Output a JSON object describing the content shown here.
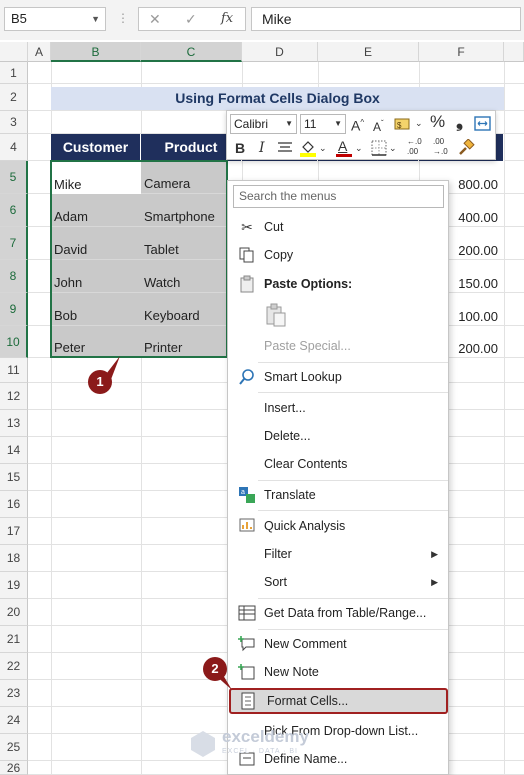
{
  "formula_bar": {
    "name_box": "B5",
    "dots": "⋮",
    "cancel_glyph": "✕",
    "enter_glyph": "✓",
    "fx_label": "fx",
    "value": "Mike"
  },
  "columns": [
    "A",
    "B",
    "C",
    "D",
    "E",
    "F"
  ],
  "rows": [
    "1",
    "2",
    "3",
    "4",
    "5",
    "6",
    "7",
    "8",
    "9",
    "10",
    "11",
    "12",
    "13",
    "14",
    "15",
    "16",
    "17",
    "18",
    "19",
    "20",
    "21",
    "22",
    "23",
    "24",
    "25",
    "26"
  ],
  "sheet": {
    "title": "Using Format Cells Dialog Box",
    "headers": {
      "customer": "Customer",
      "product": "Product"
    },
    "data": [
      {
        "customer": "Mike",
        "product": "Camera",
        "amount": "800.00"
      },
      {
        "customer": "Adam",
        "product": "Smartphone",
        "amount": "400.00"
      },
      {
        "customer": "David",
        "product": "Tablet",
        "amount": "200.00"
      },
      {
        "customer": "John",
        "product": "Watch",
        "amount": "150.00"
      },
      {
        "customer": "Bob",
        "product": "Keyboard",
        "amount": "100.00"
      },
      {
        "customer": "Peter",
        "product": "Printer",
        "amount": "200.00"
      }
    ]
  },
  "mini_toolbar": {
    "font": "Calibri",
    "size": "11",
    "grow": "A",
    "shrink": "A",
    "percent": "%",
    "comma": "❟",
    "bold": "B",
    "italic": "I",
    "font_color_letter": "A",
    "dec_inc": "←.0",
    "dec_inc_sub": ".00",
    "dec_dec": ".00",
    "dec_dec_sub": "→.0"
  },
  "context_menu": {
    "search_placeholder": "Search the menus",
    "cut": "Cut",
    "copy": "Copy",
    "paste_options": "Paste Options:",
    "paste_special": "Paste Special...",
    "smart_lookup": "Smart Lookup",
    "insert": "Insert...",
    "delete": "Delete...",
    "clear_contents": "Clear Contents",
    "translate": "Translate",
    "quick_analysis": "Quick Analysis",
    "filter": "Filter",
    "sort": "Sort",
    "get_data": "Get Data from Table/Range...",
    "new_comment": "New Comment",
    "new_note": "New Note",
    "format_cells": "Format Cells...",
    "pick_list": "Pick From Drop-down List...",
    "define_name": "Define Name..."
  },
  "badges": {
    "step1": "1",
    "step2": "2"
  },
  "watermark": {
    "name": "exceldemy",
    "tagline": "EXCEL · DATA · BI"
  },
  "colors": {
    "header_navy": "#1f2f5c",
    "title_fill": "#d9e1f2",
    "selection_gray": "#c9c9c9",
    "excel_green": "#217346",
    "badge_red": "#8b1a1a"
  }
}
